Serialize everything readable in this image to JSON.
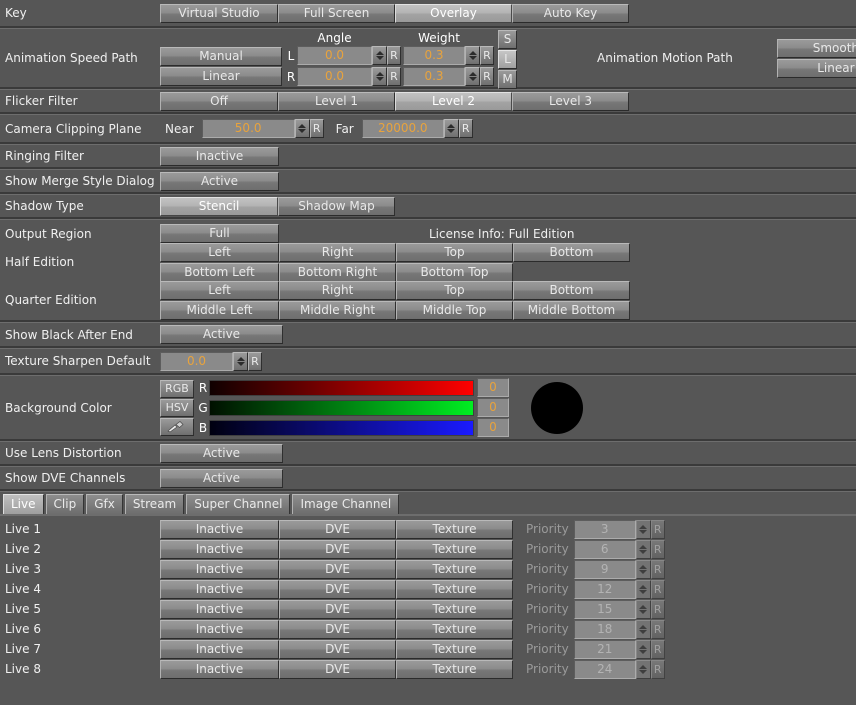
{
  "colors": {
    "window_bg": "#565656",
    "row_sep": "#3a3a3a",
    "value_text": "#e8a33d",
    "swatch": "#000000"
  },
  "key_row": {
    "label": "Key",
    "options": [
      {
        "label": "Virtual Studio",
        "selected": false
      },
      {
        "label": "Full Screen",
        "selected": false
      },
      {
        "label": "Overlay",
        "selected": true
      },
      {
        "label": "Auto Key",
        "selected": false
      }
    ]
  },
  "animation_speed_path": {
    "label": "Animation Speed Path",
    "options": [
      {
        "label": "Manual",
        "selected": false
      },
      {
        "label": "Linear",
        "selected": false
      }
    ],
    "angle_header": "Angle",
    "weight_header": "Weight",
    "rows": [
      {
        "side": "L",
        "angle": "0.0",
        "angle_reset": "R",
        "weight": "0.3",
        "weight_reset": "R"
      },
      {
        "side": "R",
        "angle": "0.0",
        "angle_reset": "R",
        "weight": "0.3",
        "weight_reset": "R"
      }
    ],
    "mode_buttons": [
      {
        "label": "S",
        "selected": false
      },
      {
        "label": "L",
        "selected": true
      },
      {
        "label": "M",
        "selected": false
      }
    ]
  },
  "animation_motion_path": {
    "label": "Animation Motion Path",
    "options": [
      {
        "label": "Smooth",
        "selected": false
      },
      {
        "label": "Linear",
        "selected": false
      }
    ]
  },
  "flicker_filter": {
    "label": "Flicker Filter",
    "options": [
      {
        "label": "Off",
        "selected": false
      },
      {
        "label": "Level 1",
        "selected": false
      },
      {
        "label": "Level 2",
        "selected": true
      },
      {
        "label": "Level 3",
        "selected": false
      }
    ]
  },
  "camera_clipping_plane": {
    "label": "Camera Clipping Plane",
    "near_label": "Near",
    "near_value": "50.0",
    "near_reset": "R",
    "far_label": "Far",
    "far_value": "20000.0",
    "far_reset": "R"
  },
  "ringing_filter": {
    "label": "Ringing Filter",
    "button": "Inactive",
    "selected": false
  },
  "show_merge_style_dialog": {
    "label": "Show Merge Style Dialog",
    "button": "Active",
    "selected": false
  },
  "shadow_type": {
    "label": "Shadow Type",
    "options": [
      {
        "label": "Stencil",
        "selected": true
      },
      {
        "label": "Shadow Map",
        "selected": false
      }
    ]
  },
  "output_region": {
    "label": "Output Region",
    "full_button": {
      "label": "Full",
      "selected": false
    },
    "license_info": "License Info: Full Edition",
    "half_edition": {
      "label": "Half Edition",
      "row1": [
        {
          "label": "Left",
          "selected": false
        },
        {
          "label": "Right",
          "selected": false
        },
        {
          "label": "Top",
          "selected": false
        },
        {
          "label": "Bottom",
          "selected": false
        }
      ],
      "row2": [
        {
          "label": "Bottom Left",
          "selected": false
        },
        {
          "label": "Bottom Right",
          "selected": false
        },
        {
          "label": "Bottom Top",
          "selected": false
        }
      ]
    },
    "quarter_edition": {
      "label": "Quarter Edition",
      "row1": [
        {
          "label": "Left",
          "selected": false
        },
        {
          "label": "Right",
          "selected": false
        },
        {
          "label": "Top",
          "selected": false
        },
        {
          "label": "Bottom",
          "selected": false
        }
      ],
      "row2": [
        {
          "label": "Middle Left",
          "selected": false
        },
        {
          "label": "Middle Right",
          "selected": false
        },
        {
          "label": "Middle Top",
          "selected": false
        },
        {
          "label": "Middle Bottom",
          "selected": false
        }
      ]
    }
  },
  "show_black_after_end": {
    "label": "Show Black After End",
    "button": "Active",
    "selected": false
  },
  "texture_sharpen_default": {
    "label": "Texture Sharpen Default",
    "value": "0.0",
    "reset": "R"
  },
  "background_color": {
    "label": "Background Color",
    "mode_rgb": "RGB",
    "mode_hsv": "HSV",
    "picker_icon": "eyedropper-icon",
    "channels": [
      {
        "letter": "R",
        "value": "0",
        "gradient_to": "#ff0000"
      },
      {
        "letter": "G",
        "value": "0",
        "gradient_to": "#00ee22"
      },
      {
        "letter": "B",
        "value": "0",
        "gradient_to": "#1a1aff"
      }
    ]
  },
  "use_lens_distortion": {
    "label": "Use Lens Distortion",
    "button": "Active",
    "selected": false
  },
  "show_dve_channels": {
    "label": "Show DVE Channels",
    "button": "Active",
    "selected": false
  },
  "tabs": [
    {
      "label": "Live",
      "active": true
    },
    {
      "label": "Clip",
      "active": false
    },
    {
      "label": "Gfx",
      "active": false
    },
    {
      "label": "Stream",
      "active": false
    },
    {
      "label": "Super Channel",
      "active": false
    },
    {
      "label": "Image Channel",
      "active": false
    }
  ],
  "channel_table": {
    "priority_label": "Priority",
    "reset_label": "R",
    "rows": [
      {
        "name": "Live 1",
        "state": "Inactive",
        "dve": "DVE",
        "texture": "Texture",
        "priority": "3"
      },
      {
        "name": "Live 2",
        "state": "Inactive",
        "dve": "DVE",
        "texture": "Texture",
        "priority": "6"
      },
      {
        "name": "Live 3",
        "state": "Inactive",
        "dve": "DVE",
        "texture": "Texture",
        "priority": "9"
      },
      {
        "name": "Live 4",
        "state": "Inactive",
        "dve": "DVE",
        "texture": "Texture",
        "priority": "12"
      },
      {
        "name": "Live 5",
        "state": "Inactive",
        "dve": "DVE",
        "texture": "Texture",
        "priority": "15"
      },
      {
        "name": "Live 6",
        "state": "Inactive",
        "dve": "DVE",
        "texture": "Texture",
        "priority": "18"
      },
      {
        "name": "Live 7",
        "state": "Inactive",
        "dve": "DVE",
        "texture": "Texture",
        "priority": "21"
      },
      {
        "name": "Live 8",
        "state": "Inactive",
        "dve": "DVE",
        "texture": "Texture",
        "priority": "24"
      }
    ]
  }
}
